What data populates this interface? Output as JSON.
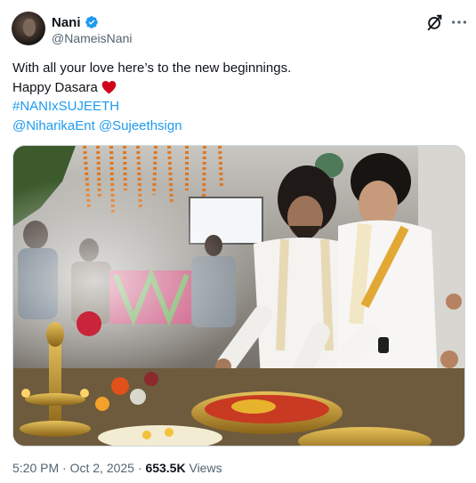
{
  "tweet": {
    "author": {
      "name": "Nani",
      "handle": "@NameisNani",
      "verified": true
    },
    "text_lines": [
      "With all your love here’s to the new beginnings.",
      "Happy Dasara"
    ],
    "hashtag": "#NANIxSUJEETH",
    "mentions": [
      "@NiharikaEnt",
      "@Sujeethsign"
    ],
    "emoji": "red-heart",
    "image": "Two men in white shirts and cream dhotis performing a pooja ritual with flowers, brass lamps and offerings on a film set",
    "footer": {
      "time": "5:20 PM",
      "separator": "·",
      "date": "Oct 2, 2025",
      "views_count": "653.5K",
      "views_label": "Views"
    }
  },
  "icons": {
    "grok": "grok-icon",
    "more": "more-horizontal-icon",
    "verified": "verified-badge-icon"
  },
  "colors": {
    "link": "#1d9bf0",
    "verified": "#1d9bf0",
    "heart": "#d0021b",
    "secondary_text": "#536471"
  }
}
